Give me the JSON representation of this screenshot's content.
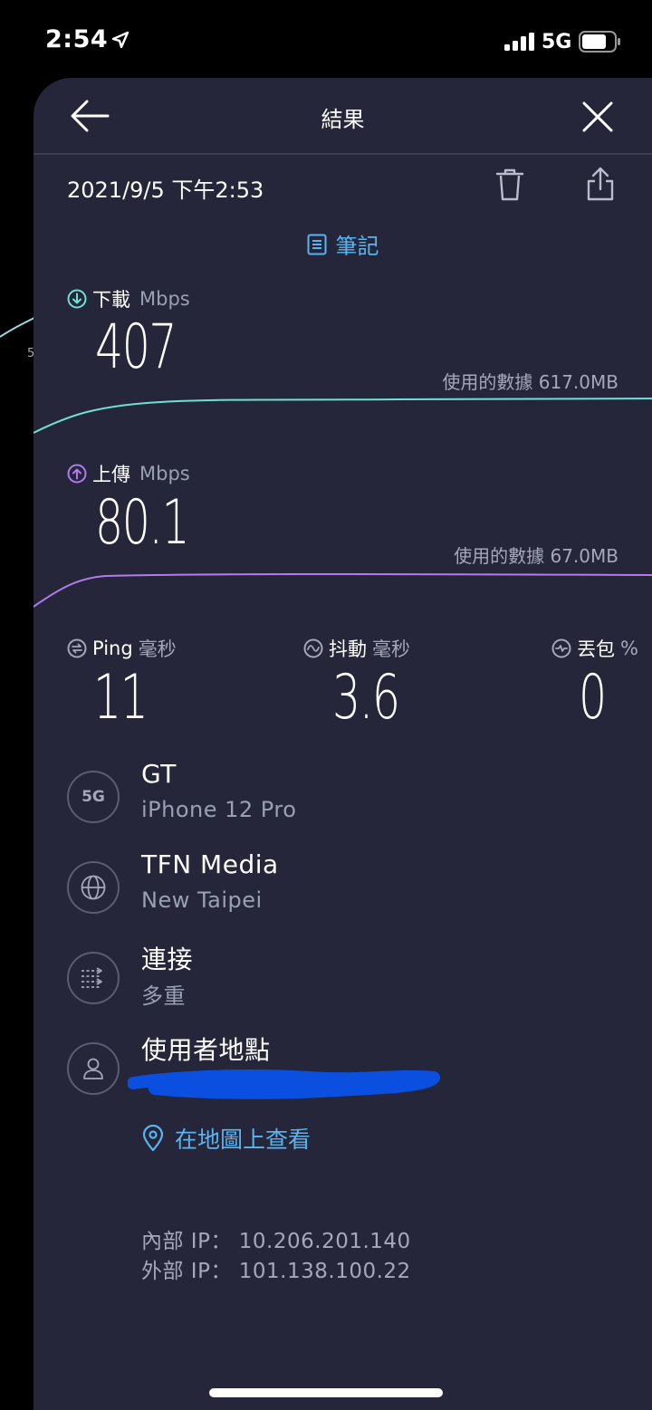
{
  "status_bar": {
    "time": "2:54",
    "network": "5G"
  },
  "background": {
    "peek_label": "5"
  },
  "nav": {
    "title": "結果"
  },
  "result": {
    "date": "2021/9/5 下午2:53",
    "notes_label": "筆記"
  },
  "download": {
    "label": "下載",
    "unit": "Mbps",
    "value": "407",
    "data_used": "使用的數據 617.0MB"
  },
  "upload": {
    "label": "上傳",
    "unit": "Mbps",
    "value": "80.1",
    "data_used": "使用的數據 67.0MB"
  },
  "ping": {
    "label": "Ping",
    "unit": "毫秒",
    "value": "11"
  },
  "jitter": {
    "label": "抖動",
    "unit": "毫秒",
    "value": "3.6"
  },
  "loss": {
    "label": "丟包",
    "unit": "%",
    "value": "0"
  },
  "info": {
    "carrier": {
      "badge": "5G",
      "title": "GT",
      "subtitle": "iPhone 12 Pro"
    },
    "server": {
      "title": "TFN Media",
      "subtitle": "New Taipei"
    },
    "connection": {
      "title": "連接",
      "subtitle": "多重"
    },
    "location": {
      "title": "使用者地點"
    }
  },
  "map_link": "在地圖上查看",
  "ip": {
    "internal": "內部 IP： 10.206.201.140",
    "external": "外部 IP： 101.138.100.22"
  },
  "colors": {
    "sheet_bg": "#252639",
    "download": "#6fe0d4",
    "upload": "#b27cf0",
    "link": "#5ab4f0",
    "redaction": "#0a4fe0"
  }
}
